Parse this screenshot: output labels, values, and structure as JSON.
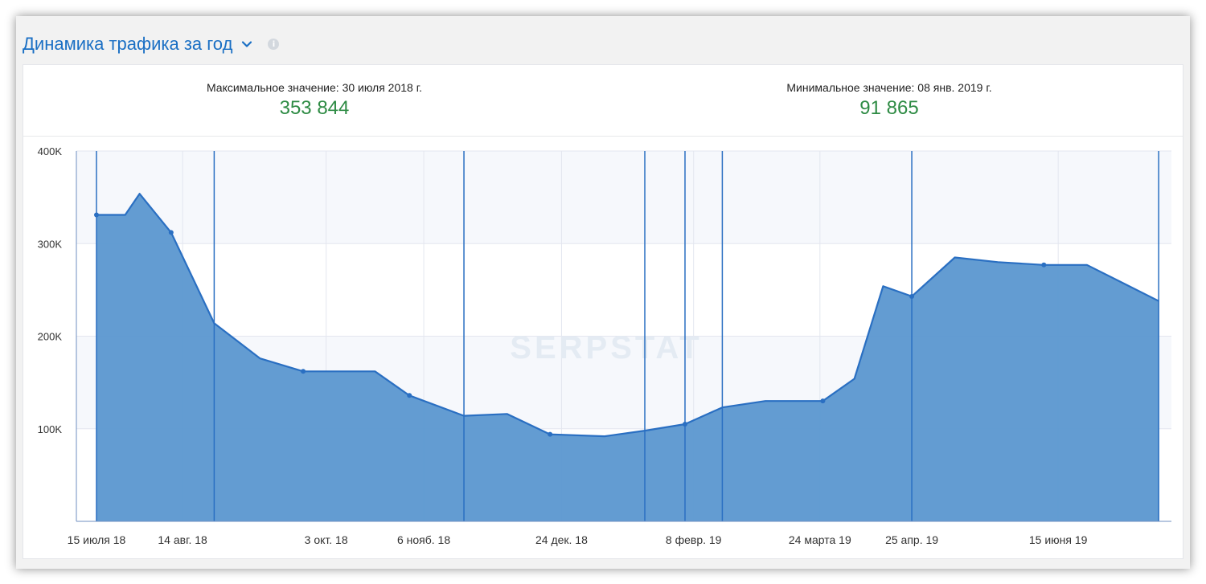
{
  "widget": {
    "title": "Динамика трафика за год",
    "chevron_icon": "chevron-down-icon",
    "info_icon": "info-icon",
    "info_glyph": "i"
  },
  "stats": {
    "max_label": "Максимальное значение: 30 июля 2018 г.",
    "max_value": "353 844",
    "min_label": "Минимальное значение: 08 янв. 2019 г.",
    "min_value": "91 865"
  },
  "colors": {
    "title": "#1a6fc4",
    "value": "#2e8b44",
    "area_fill": "#5b97d0",
    "line": "#2a6fc2",
    "grid": "#e3e6ef",
    "band": "#f6f8fc"
  },
  "chart_data": {
    "type": "area",
    "watermark": "SERPSTAT",
    "ylim": [
      0,
      400000
    ],
    "y_ticks": [
      {
        "value": 100000,
        "label": "100K"
      },
      {
        "value": 200000,
        "label": "200K"
      },
      {
        "value": 300000,
        "label": "300K"
      },
      {
        "value": 400000,
        "label": "400K"
      }
    ],
    "xlim": [
      "2018-07-15",
      "2019-07-25"
    ],
    "x_ticks": [
      {
        "date": "2018-07-15",
        "label": "15 июля 18"
      },
      {
        "date": "2018-08-14",
        "label": "14 авг. 18"
      },
      {
        "date": "2018-10-03",
        "label": "3 окт. 18"
      },
      {
        "date": "2018-11-06",
        "label": "6 нояб. 18"
      },
      {
        "date": "2018-12-24",
        "label": "24 дек. 18"
      },
      {
        "date": "2019-02-08",
        "label": "8 февр. 19"
      },
      {
        "date": "2019-03-24",
        "label": "24 марта 19"
      },
      {
        "date": "2019-04-25",
        "label": "25 апр. 19"
      },
      {
        "date": "2019-06-15",
        "label": "15 июня 19"
      }
    ],
    "series": [
      {
        "points": [
          {
            "x": "2018-07-15",
            "y": 331000,
            "marker": true
          },
          {
            "x": "2018-07-25",
            "y": 331000,
            "marker": false
          },
          {
            "x": "2018-07-30",
            "y": 353844,
            "marker": false
          },
          {
            "x": "2018-08-10",
            "y": 312000,
            "marker": true
          },
          {
            "x": "2018-08-25",
            "y": 214000,
            "marker": false
          },
          {
            "x": "2018-09-10",
            "y": 176000,
            "marker": false
          },
          {
            "x": "2018-09-25",
            "y": 162000,
            "marker": true
          },
          {
            "x": "2018-10-20",
            "y": 162000,
            "marker": false
          },
          {
            "x": "2018-11-01",
            "y": 136000,
            "marker": true
          },
          {
            "x": "2018-11-20",
            "y": 114000,
            "marker": false
          },
          {
            "x": "2018-12-05",
            "y": 116000,
            "marker": false
          },
          {
            "x": "2018-12-20",
            "y": 94000,
            "marker": true
          },
          {
            "x": "2019-01-08",
            "y": 91865,
            "marker": false
          },
          {
            "x": "2019-01-22",
            "y": 98000,
            "marker": false
          },
          {
            "x": "2019-02-05",
            "y": 105000,
            "marker": true
          },
          {
            "x": "2019-02-18",
            "y": 123000,
            "marker": false
          },
          {
            "x": "2019-03-05",
            "y": 130000,
            "marker": false
          },
          {
            "x": "2019-03-25",
            "y": 130000,
            "marker": true
          },
          {
            "x": "2019-04-05",
            "y": 154000,
            "marker": false
          },
          {
            "x": "2019-04-15",
            "y": 254000,
            "marker": false
          },
          {
            "x": "2019-04-25",
            "y": 243000,
            "marker": true
          },
          {
            "x": "2019-05-10",
            "y": 285000,
            "marker": false
          },
          {
            "x": "2019-05-25",
            "y": 280000,
            "marker": false
          },
          {
            "x": "2019-06-10",
            "y": 277000,
            "marker": true
          },
          {
            "x": "2019-06-25",
            "y": 277000,
            "marker": false
          },
          {
            "x": "2019-07-20",
            "y": 238000,
            "marker": false
          }
        ]
      }
    ],
    "event_lines": [
      "2018-07-15",
      "2018-08-25",
      "2018-11-20",
      "2019-01-22",
      "2019-02-05",
      "2019-02-18",
      "2019-04-25",
      "2019-07-20"
    ],
    "grid": true
  }
}
